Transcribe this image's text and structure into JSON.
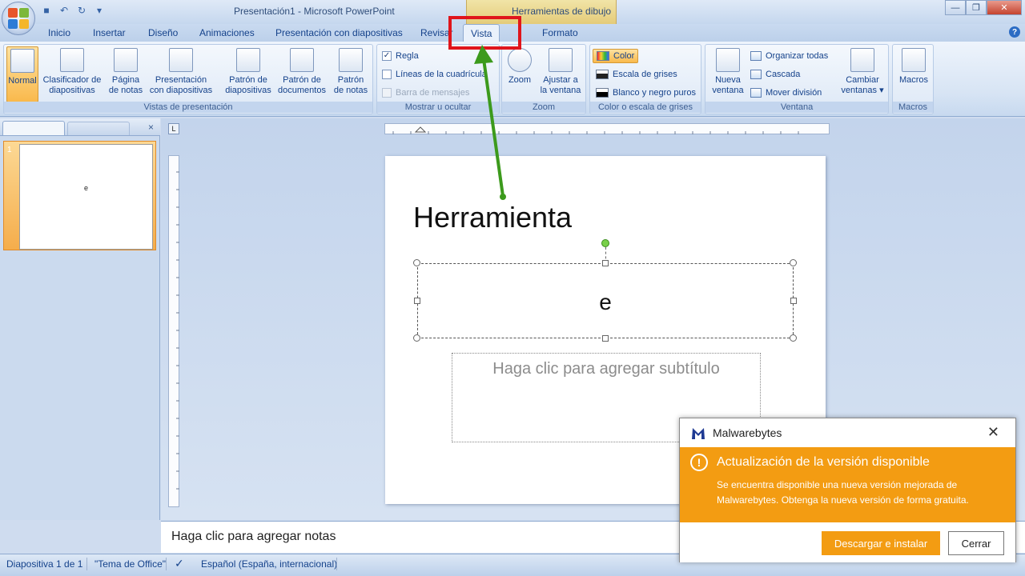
{
  "window": {
    "title": "Presentación1 - Microsoft PowerPoint",
    "context_title": "Herramientas de dibujo"
  },
  "tabs": [
    {
      "label": "Inicio"
    },
    {
      "label": "Insertar"
    },
    {
      "label": "Diseño"
    },
    {
      "label": "Animaciones"
    },
    {
      "label": "Presentación con diapositivas"
    },
    {
      "label": "Revisar"
    },
    {
      "label": "Vista"
    },
    {
      "label": "Formato"
    }
  ],
  "ribbon": {
    "vistas": {
      "label": "Vistas de presentación",
      "normal": "Normal",
      "clasificador_1": "Clasificador de",
      "clasificador_2": "diapositivas",
      "pagina_1": "Página",
      "pagina_2": "de notas",
      "presentacion_1": "Presentación",
      "presentacion_2": "con diapositivas"
    },
    "patrones": {
      "patron_diap_1": "Patrón de",
      "patron_diap_2": "diapositivas",
      "patron_doc_1": "Patrón de",
      "patron_doc_2": "documentos",
      "patron_notas_1": "Patrón",
      "patron_notas_2": "de notas"
    },
    "mostrar": {
      "label": "Mostrar u ocultar",
      "regla": "Regla",
      "lineas": "Líneas de la cuadrícula",
      "barra": "Barra de mensajes"
    },
    "zoom": {
      "label": "Zoom",
      "zoom": "Zoom",
      "ajustar_1": "Ajustar a",
      "ajustar_2": "la ventana"
    },
    "color": {
      "label": "Color o escala de grises",
      "color": "Color",
      "grises": "Escala de grises",
      "bn": "Blanco y negro puros"
    },
    "ventana": {
      "label": "Ventana",
      "nueva_1": "Nueva",
      "nueva_2": "ventana",
      "organizar": "Organizar todas",
      "cascada": "Cascada",
      "mover": "Mover división",
      "cambiar_1": "Cambiar",
      "cambiar_2": "ventanas"
    },
    "macros": {
      "label": "Macros",
      "macros": "Macros"
    }
  },
  "panel": {
    "close": "×",
    "thumb_number": "1",
    "thumb_text": "e"
  },
  "slide": {
    "title": "Herramienta",
    "selected_text": "e",
    "subtitle_placeholder": "Haga clic para agregar subtítulo"
  },
  "notes": {
    "placeholder": "Haga clic para agregar notas"
  },
  "status": {
    "slide": "Diapositiva 1 de 1",
    "theme": "\"Tema de Office\"",
    "language": "Español (España, internacional)"
  },
  "toast": {
    "app": "Malwarebytes",
    "close": "✕",
    "heading": "Actualización de la versión disponible",
    "message": "Se encuentra disponible una nueva versión mejorada de Malwarebytes. Obtenga la nueva versión de forma gratuita.",
    "primary": "Descargar e instalar",
    "secondary": "Cerrar",
    "accent": "#f39c12"
  },
  "colors": {
    "highlight": "#e0151b",
    "arrow": "#3c9a1c"
  }
}
